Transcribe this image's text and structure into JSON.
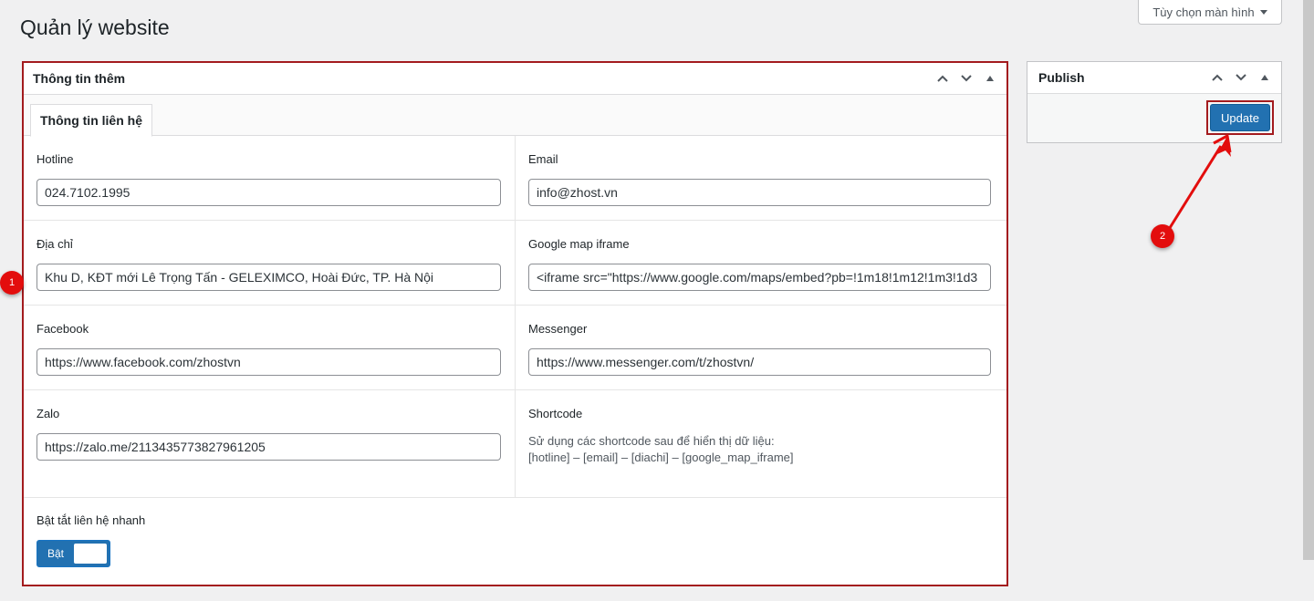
{
  "page": {
    "title": "Quản lý website"
  },
  "screen_options": {
    "label": "Tùy chọn màn hình"
  },
  "metabox": {
    "title": "Thông tin thêm",
    "tab_label": "Thông tin liên hệ",
    "fields": {
      "hotline": {
        "label": "Hotline",
        "value": "024.7102.1995"
      },
      "email": {
        "label": "Email",
        "value": "info@zhost.vn"
      },
      "address": {
        "label": "Địa chỉ",
        "value": "Khu D, KĐT mới Lê Trọng Tấn - GELEXIMCO, Hoài Đức, TP. Hà Nội"
      },
      "google_map": {
        "label": "Google map iframe",
        "value": "<iframe src=\"https://www.google.com/maps/embed?pb=!1m18!1m12!1m3!1d3"
      },
      "facebook": {
        "label": "Facebook",
        "value": "https://www.facebook.com/zhostvn"
      },
      "messenger": {
        "label": "Messenger",
        "value": "https://www.messenger.com/t/zhostvn/"
      },
      "zalo": {
        "label": "Zalo",
        "value": "https://zalo.me/2113435773827961205"
      },
      "shortcode": {
        "label": "Shortcode",
        "line1": "Sử dụng các shortcode sau để hiển thị dữ liệu:",
        "line2": "[hotline] – [email] – [diachi] – [google_map_iframe]"
      }
    },
    "toggle": {
      "label": "Bật tắt liên hệ nhanh",
      "state_text": "Bật"
    }
  },
  "publish": {
    "title": "Publish",
    "update_label": "Update"
  },
  "annotations": {
    "badge1": "1",
    "badge2": "2"
  },
  "colors": {
    "accent": "#2271b1",
    "highlight": "#a31b1e",
    "badge": "#e30d0d"
  }
}
